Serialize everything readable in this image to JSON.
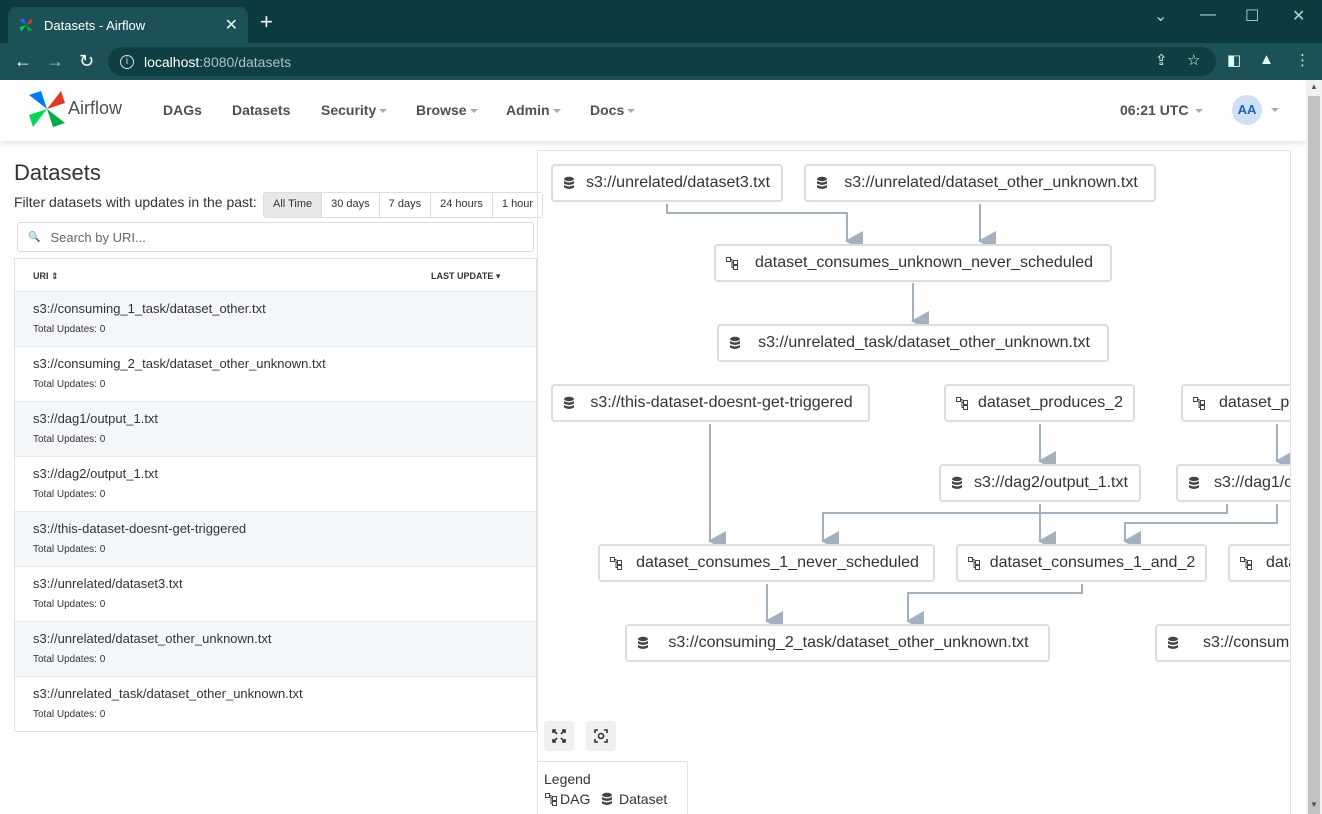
{
  "browser": {
    "tab_title": "Datasets - Airflow",
    "url_host": "localhost",
    "url_path": ":8080/datasets"
  },
  "navbar": {
    "brand": "Airflow",
    "menu": [
      "DAGs",
      "Datasets",
      "Security",
      "Browse",
      "Admin",
      "Docs"
    ],
    "clock": "06:21 UTC",
    "avatar": "AA"
  },
  "page": {
    "title": "Datasets",
    "filter_label": "Filter datasets with updates in the past:",
    "filters": [
      "All Time",
      "30 days",
      "7 days",
      "24 hours",
      "1 hour"
    ],
    "active_filter": "All Time",
    "search_placeholder": "Search by URI..."
  },
  "table": {
    "headers": [
      "URI",
      "LAST UPDATE"
    ],
    "rows": [
      {
        "uri": "s3://consuming_1_task/dataset_other.txt",
        "updates": "Total Updates: 0"
      },
      {
        "uri": "s3://consuming_2_task/dataset_other_unknown.txt",
        "updates": "Total Updates: 0"
      },
      {
        "uri": "s3://dag1/output_1.txt",
        "updates": "Total Updates: 0"
      },
      {
        "uri": "s3://dag2/output_1.txt",
        "updates": "Total Updates: 0"
      },
      {
        "uri": "s3://this-dataset-doesnt-get-triggered",
        "updates": "Total Updates: 0"
      },
      {
        "uri": "s3://unrelated/dataset3.txt",
        "updates": "Total Updates: 0"
      },
      {
        "uri": "s3://unrelated/dataset_other_unknown.txt",
        "updates": "Total Updates: 0"
      },
      {
        "uri": "s3://unrelated_task/dataset_other_unknown.txt",
        "updates": "Total Updates: 0"
      }
    ]
  },
  "graph": {
    "nodes": [
      {
        "label": "s3://unrelated/dataset3.txt",
        "kind": "dataset"
      },
      {
        "label": "s3://unrelated/dataset_other_unknown.txt",
        "kind": "dataset"
      },
      {
        "label": "dataset_consumes_unknown_never_scheduled",
        "kind": "dag"
      },
      {
        "label": "s3://unrelated_task/dataset_other_unknown.txt",
        "kind": "dataset"
      },
      {
        "label": "s3://this-dataset-doesnt-get-triggered",
        "kind": "dataset"
      },
      {
        "label": "dataset_produces_2",
        "kind": "dag"
      },
      {
        "label": "dataset_p",
        "kind": "dag"
      },
      {
        "label": "s3://dag2/output_1.txt",
        "kind": "dataset"
      },
      {
        "label": "s3://dag1/c",
        "kind": "dataset"
      },
      {
        "label": "dataset_consumes_1_never_scheduled",
        "kind": "dag"
      },
      {
        "label": "dataset_consumes_1_and_2",
        "kind": "dag"
      },
      {
        "label": "data",
        "kind": "dag"
      },
      {
        "label": "s3://consuming_2_task/dataset_other_unknown.txt",
        "kind": "dataset"
      },
      {
        "label": "s3://consum",
        "kind": "dataset"
      }
    ],
    "legend_title": "Legend",
    "legend_dag": "DAG",
    "legend_dataset": "Dataset"
  }
}
